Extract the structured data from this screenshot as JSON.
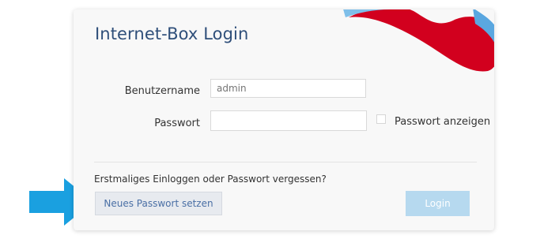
{
  "login": {
    "title": "Internet-Box Login",
    "username_label": "Benutzername",
    "username_placeholder": "admin",
    "password_label": "Passwort",
    "password_value": "",
    "show_password_label": "Passwort anzeigen",
    "show_password_checked": false,
    "forgot_text": "Erstmaliges Einloggen oder Passwort vergessen?",
    "reset_button_label": "Neues Passwort setzen",
    "login_button_label": "Login"
  },
  "colors": {
    "title": "#2f4f7a",
    "brand_red": "#d2001e",
    "brand_blue": "#5aa7e0",
    "arrow_blue": "#1aa0e0",
    "login_button": "#b6d9ef"
  },
  "icons": {
    "arrow": "right-arrow-icon",
    "brand": "brand-wave-logo"
  }
}
